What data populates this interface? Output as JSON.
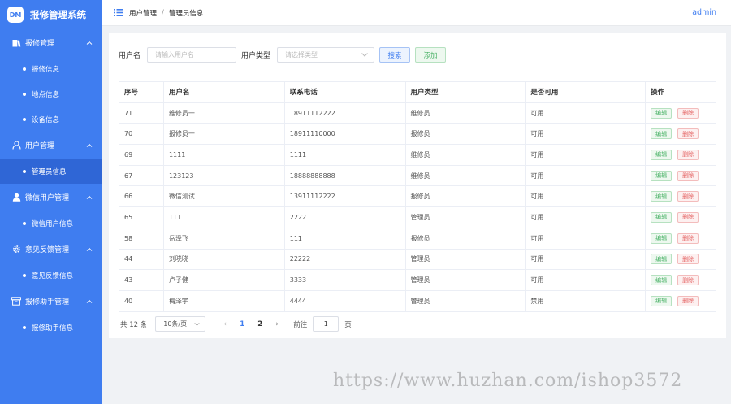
{
  "brand": {
    "logo_text": "DM",
    "title": "报修管理系统"
  },
  "sidebar": {
    "groups": [
      {
        "label": "报修管理",
        "icon": "book-icon",
        "items": [
          "报修信息",
          "地点信息",
          "设备信息"
        ]
      },
      {
        "label": "用户管理",
        "icon": "user-icon",
        "items": [
          "管理员信息"
        ]
      },
      {
        "label": "微信用户管理",
        "icon": "person-icon",
        "items": [
          "微信用户信息"
        ]
      },
      {
        "label": "意见反馈管理",
        "icon": "gear-icon",
        "items": [
          "意见反馈信息"
        ]
      },
      {
        "label": "报修助手管理",
        "icon": "box-icon",
        "items": [
          "报修助手信息"
        ]
      }
    ],
    "active_item": "管理员信息"
  },
  "header": {
    "breadcrumb": [
      "用户管理",
      "管理员信息"
    ],
    "breadcrumb_sep": "/",
    "user": "admin"
  },
  "filter": {
    "username_label": "用户名",
    "username_placeholder": "请输入用户名",
    "usertype_label": "用户类型",
    "usertype_placeholder": "请选择类型",
    "search_label": "搜索",
    "add_label": "添加"
  },
  "table": {
    "columns": [
      "序号",
      "用户名",
      "联系电话",
      "用户类型",
      "是否可用",
      "操作"
    ],
    "edit_label": "编辑",
    "delete_label": "删除",
    "rows": [
      [
        "71",
        "维修员一",
        "18911112222",
        "维修员",
        "可用"
      ],
      [
        "70",
        "报修员一",
        "18911110000",
        "报修员",
        "可用"
      ],
      [
        "69",
        "1111",
        "1111",
        "维修员",
        "可用"
      ],
      [
        "67",
        "123123",
        "18888888888",
        "维修员",
        "可用"
      ],
      [
        "66",
        "微信测试",
        "13911112222",
        "报修员",
        "可用"
      ],
      [
        "65",
        "111",
        "2222",
        "管理员",
        "可用"
      ],
      [
        "58",
        "岳泽飞",
        "111",
        "报修员",
        "可用"
      ],
      [
        "44",
        "刘晓晓",
        "22222",
        "管理员",
        "可用"
      ],
      [
        "43",
        "卢子健",
        "3333",
        "管理员",
        "可用"
      ],
      [
        "40",
        "梅泽宇",
        "4444",
        "管理员",
        "禁用"
      ]
    ]
  },
  "pagination": {
    "total_text": "共 12 条",
    "page_size": "10条/页",
    "prev": "‹",
    "next": "›",
    "pages": [
      "1",
      "2"
    ],
    "current_page": "1",
    "goto_label": "前往",
    "goto_value": "1",
    "goto_unit": "页"
  },
  "watermark": "https://www.huzhan.com/ishop3572",
  "colors": {
    "primary": "#3f7df0",
    "active_menu": "#2f66d6",
    "success": "#4ab267",
    "danger": "#e46363"
  }
}
